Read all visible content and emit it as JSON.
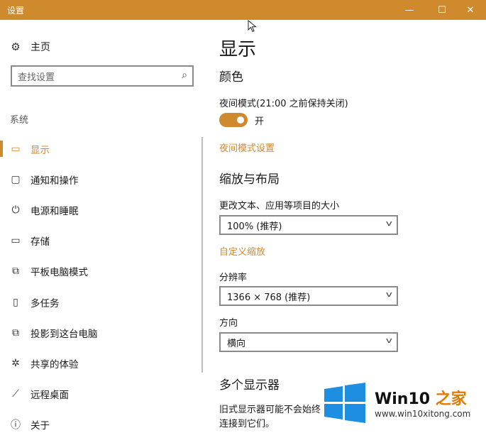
{
  "window": {
    "title": "设置",
    "minimize": "—",
    "maximize": "☐",
    "close": "✕"
  },
  "sidebar": {
    "home": {
      "label": "主页",
      "icon": "gear-icon"
    },
    "search": {
      "placeholder": "查找设置",
      "icon": "search-icon"
    },
    "section_label": "系统",
    "items": [
      {
        "label": "显示",
        "icon": "monitor-icon",
        "glyph": "▭",
        "active": true
      },
      {
        "label": "通知和操作",
        "icon": "speech-bubble-icon",
        "glyph": "▢",
        "active": false
      },
      {
        "label": "电源和睡眠",
        "icon": "power-icon",
        "glyph": "⏻",
        "active": false
      },
      {
        "label": "存储",
        "icon": "storage-icon",
        "glyph": "▭",
        "active": false
      },
      {
        "label": "平板电脑模式",
        "icon": "tablet-mode-icon",
        "glyph": "⧉",
        "active": false
      },
      {
        "label": "多任务",
        "icon": "multitasking-icon",
        "glyph": "▯",
        "active": false
      },
      {
        "label": "投影到这台电脑",
        "icon": "project-icon",
        "glyph": "⧉",
        "active": false
      },
      {
        "label": "共享的体验",
        "icon": "shared-experiences-icon",
        "glyph": "✲",
        "active": false
      },
      {
        "label": "远程桌面",
        "icon": "remote-desktop-icon",
        "glyph": "⟋",
        "active": false
      },
      {
        "label": "关于",
        "icon": "info-icon",
        "glyph": "ⓘ",
        "active": false
      }
    ]
  },
  "main": {
    "title": "显示",
    "color_heading": "颜色",
    "night_light_label": "夜间模式(21:00 之前保持关闭)",
    "night_light_toggle": {
      "on": true,
      "state_label": "开"
    },
    "night_light_settings_link": "夜间模式设置",
    "scale_heading": "缩放与布局",
    "scale_label": "更改文本、应用等项目的大小",
    "scale_value": "100% (推荐)",
    "custom_scaling_link": "自定义缩放",
    "resolution_label": "分辨率",
    "resolution_value": "1366 × 768 (推荐)",
    "orientation_label": "方向",
    "orientation_value": "横向",
    "multi_display_heading": "多个显示器",
    "multi_display_desc_line1": "旧式显示器可能不会始终",
    "multi_display_desc_line2": "连接到它们。"
  },
  "watermark": {
    "title_prefix": "Win10 ",
    "title_accent": "之家",
    "url": "www.win10xitong.com",
    "colors": {
      "logo": "#1e8fe0",
      "accent": "#e07b00"
    }
  },
  "colors": {
    "accent": "#d08a2e",
    "titlebar": "#d08a2e"
  }
}
